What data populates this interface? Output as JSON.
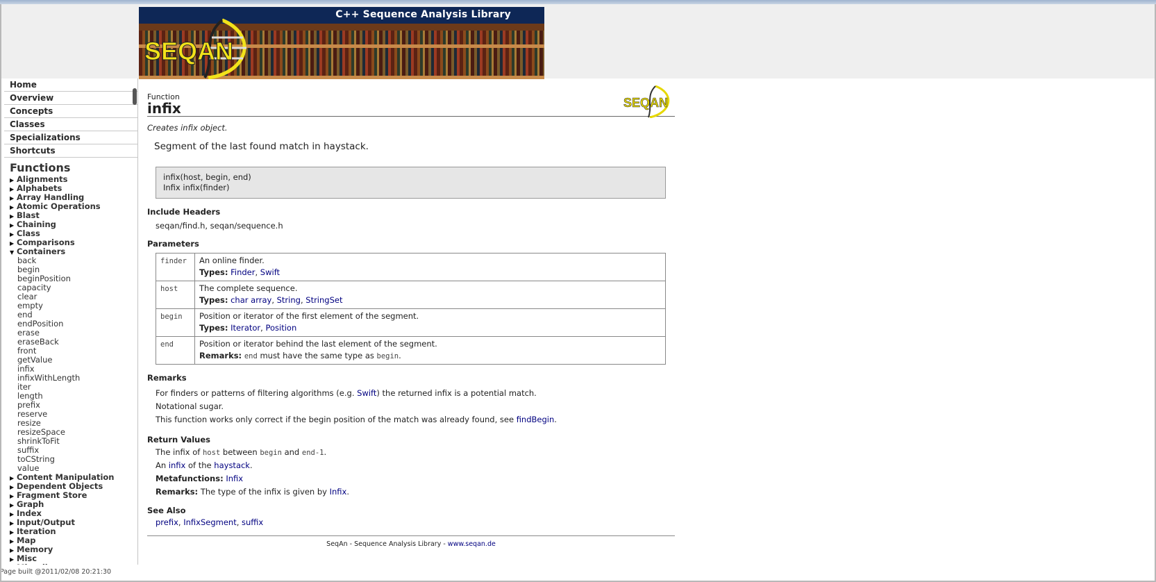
{
  "banner": {
    "title": "C++ Sequence Analysis Library",
    "logo_text": "SEQAN"
  },
  "sidebar": {
    "nav": [
      "Home",
      "Overview",
      "Concepts",
      "Classes",
      "Specializations",
      "Shortcuts"
    ],
    "functions_heading": "Functions",
    "categories_before": [
      "Alignments",
      "Alphabets",
      "Array Handling",
      "Atomic Operations",
      "Blast",
      "Chaining",
      "Class",
      "Comparisons"
    ],
    "expanded_category": "Containers",
    "container_functions": [
      "back",
      "begin",
      "beginPosition",
      "capacity",
      "clear",
      "empty",
      "end",
      "endPosition",
      "erase",
      "eraseBack",
      "front",
      "getValue",
      "infix",
      "infixWithLength",
      "iter",
      "length",
      "prefix",
      "reserve",
      "resize",
      "resizeSpace",
      "shrinkToFit",
      "suffix",
      "toCString",
      "value"
    ],
    "categories_after": [
      "Content Manipulation",
      "Dependent Objects",
      "Fragment Store",
      "Graph",
      "Index",
      "Input/Output",
      "Iteration",
      "Map",
      "Memory",
      "Misc",
      "Miscellaneous"
    ]
  },
  "page_built": "Page built @2011/02/08 20:21:30",
  "main": {
    "kind": "Function",
    "title": "infix",
    "small_logo_text": "SEQAN",
    "brief": "Creates infix object.",
    "summary": "Segment of the last found match in haystack.",
    "signature": [
      "infix(host, begin, end)",
      "Infix infix(finder)"
    ],
    "include_headers": {
      "heading": "Include Headers",
      "value": "seqan/find.h, seqan/sequence.h"
    },
    "parameters": {
      "heading": "Parameters",
      "types_label": "Types:",
      "remarks_label": "Remarks:",
      "rows": [
        {
          "name": "finder",
          "desc": "An online finder.",
          "types": [
            "Finder",
            "Swift"
          ]
        },
        {
          "name": "host",
          "desc": "The complete sequence.",
          "types": [
            "char array",
            "String",
            "StringSet"
          ]
        },
        {
          "name": "begin",
          "desc": "Position or iterator of the first element of the segment.",
          "types": [
            "Iterator",
            "Position"
          ]
        },
        {
          "name": "end",
          "desc": "Position or iterator behind the last element of the segment.",
          "remark_code1": "end",
          "remark_mid": " must have the same type as ",
          "remark_code2": "begin",
          "remark_end": "."
        }
      ]
    },
    "remarks": {
      "heading": "Remarks",
      "line1_pre": "For finders or patterns of filtering algorithms (e.g. ",
      "line1_link": "Swift",
      "line1_post": ") the returned infix is a potential match.",
      "line2": "Notational sugar.",
      "line3_pre": "This function works only correct if the begin position of the match was already found, see ",
      "line3_link": "findBegin",
      "line3_post": "."
    },
    "return_values": {
      "heading": "Return Values",
      "line1_a": "The infix of ",
      "line1_code1": "host",
      "line1_b": " between ",
      "line1_code2": "begin",
      "line1_c": " and ",
      "line1_code3": "end-1",
      "line1_d": ".",
      "line2_a": "An ",
      "line2_link1": "infix",
      "line2_b": " of the ",
      "line2_link2": "haystack",
      "line2_c": ".",
      "metafunctions_label": "Metafunctions:",
      "metafunctions_link": "Infix",
      "remarks_label": "Remarks:",
      "remarks_text": " The type of the infix is given by ",
      "remarks_link": "Infix",
      "remarks_end": "."
    },
    "see_also": {
      "heading": "See Also",
      "links": [
        "prefix",
        "InfixSegment",
        "suffix"
      ]
    },
    "footer": {
      "text": "SeqAn - Sequence Analysis Library - ",
      "link": "www.seqan.de"
    }
  }
}
